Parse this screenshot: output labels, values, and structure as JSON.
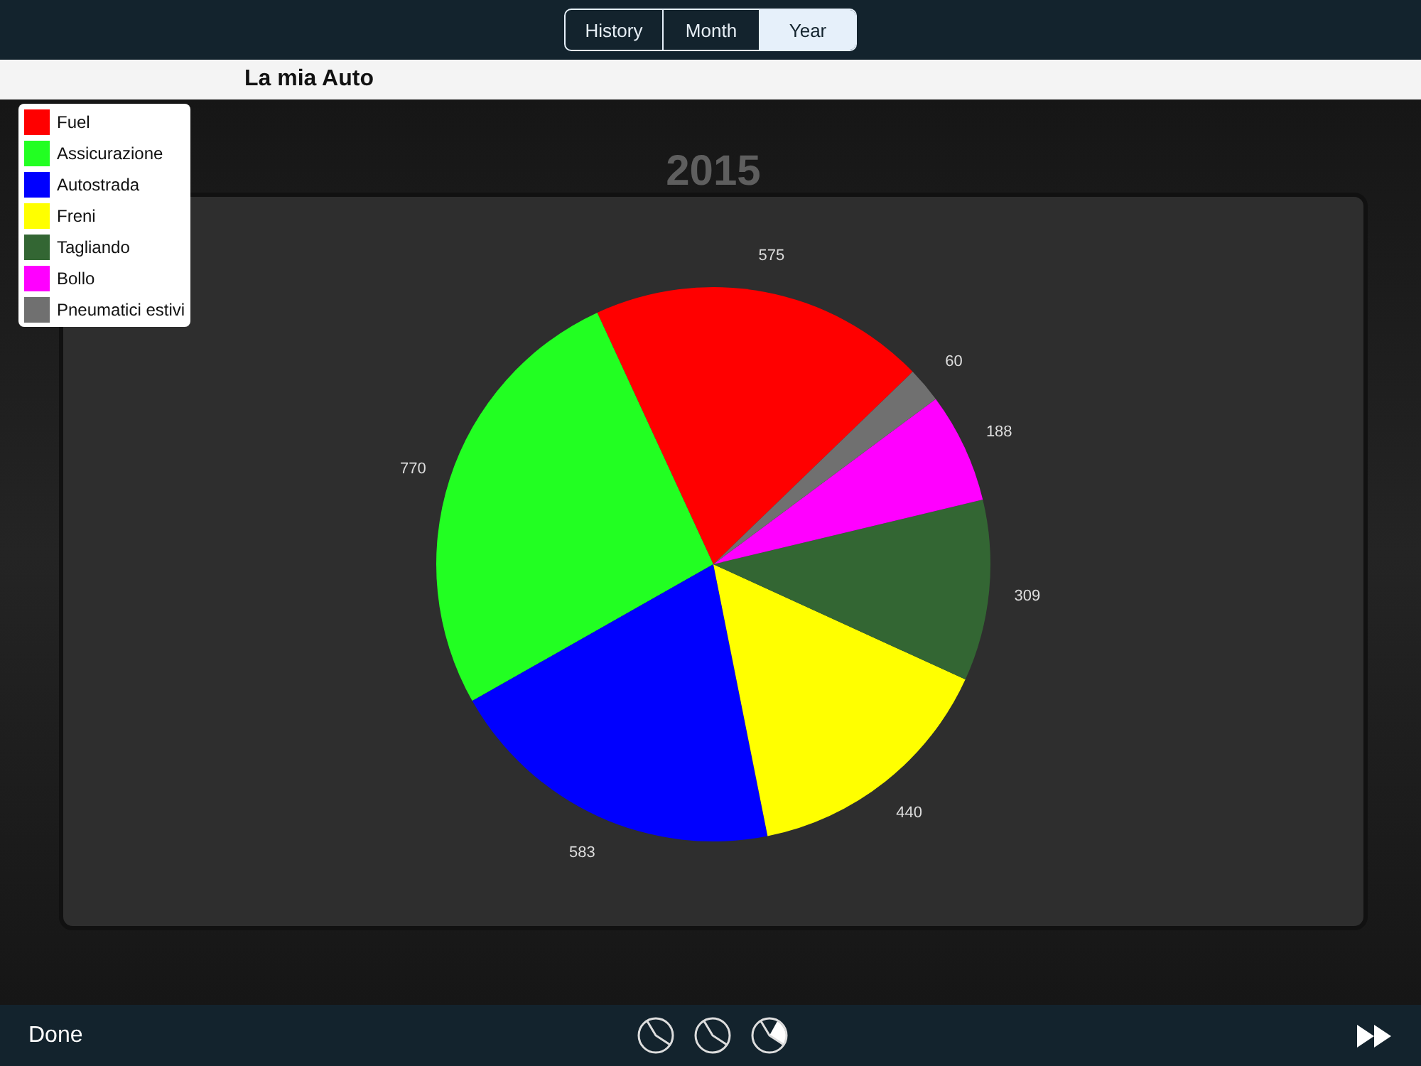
{
  "tabs": [
    {
      "label": "History",
      "selected": false
    },
    {
      "label": "Month",
      "selected": false
    },
    {
      "label": "Year",
      "selected": true
    }
  ],
  "header": {
    "title": "La mia Auto"
  },
  "legend": [
    {
      "color": "#ff0000"
    },
    {
      "color": "#22ff22"
    },
    {
      "color": "#0000ff"
    },
    {
      "color": "#ffff00"
    },
    {
      "color": "#336633"
    },
    {
      "color": "#ff00ff"
    },
    {
      "color": "#707070"
    }
  ],
  "chart_data": {
    "type": "pie",
    "title": "2015",
    "categories": [
      "Fuel",
      "Assicurazione",
      "Autostrada",
      "Freni",
      "Tagliando",
      "Bollo",
      "Pneumatici estivi"
    ],
    "values": [
      575,
      770,
      583,
      440,
      309,
      188,
      60
    ],
    "data_labels": true
  },
  "toolbar": {
    "done": "Done",
    "chart_buttons": [
      {
        "selected": false
      },
      {
        "selected": false
      },
      {
        "selected": true
      }
    ]
  }
}
